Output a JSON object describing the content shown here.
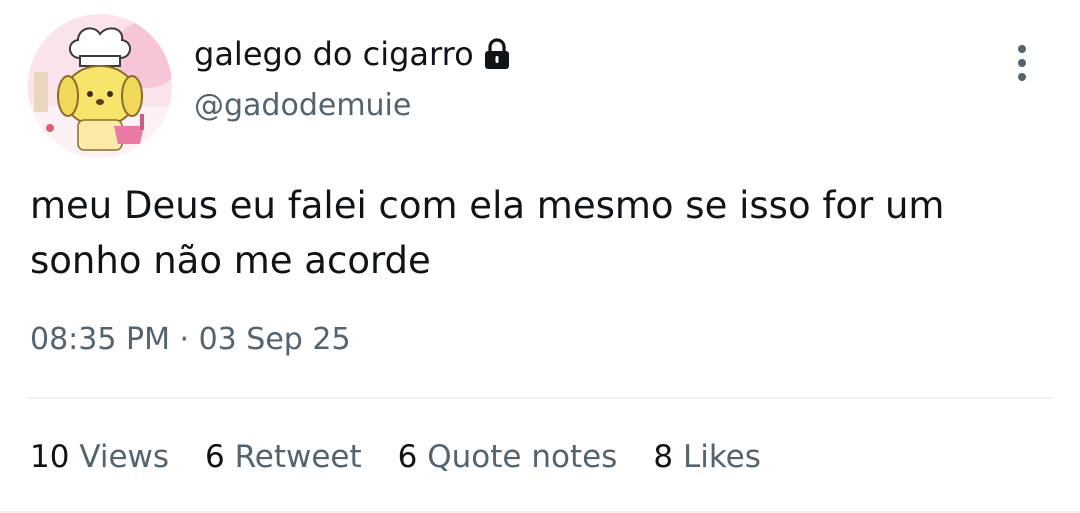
{
  "author": {
    "display_name": "galego do cigarro",
    "handle": "@gadodemuie",
    "protected_icon": "lock-icon",
    "avatar_icon": "chef-puppy-avatar"
  },
  "tweet": {
    "text": "meu Deus eu falei com ela mesmo se isso for um sonho não me acorde",
    "timestamp": "08:35 PM · 03 Sep 25"
  },
  "stats": [
    {
      "count": "10",
      "label": "Views"
    },
    {
      "count": "6",
      "label": "Retweet"
    },
    {
      "count": "6",
      "label": "Quote notes"
    },
    {
      "count": "8",
      "label": "Likes"
    }
  ],
  "more_icon": "more-vertical-icon",
  "colors": {
    "text_primary": "#0f1419",
    "text_secondary": "#536471",
    "divider": "#eff3f4",
    "avatar_bg": "#f9dbe6",
    "avatar_character": "#f7e46b"
  }
}
